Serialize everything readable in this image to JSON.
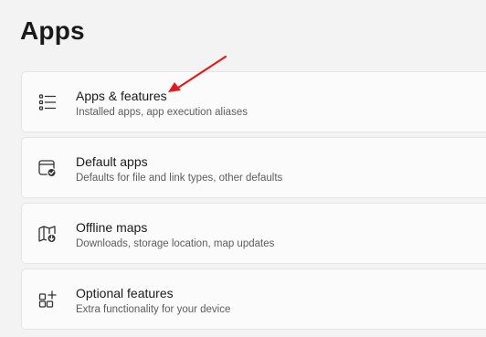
{
  "page": {
    "title": "Apps"
  },
  "items": [
    {
      "title": "Apps & features",
      "subtitle": "Installed apps, app execution aliases",
      "icon": "apps-list-icon"
    },
    {
      "title": "Default apps",
      "subtitle": "Defaults for file and link types, other defaults",
      "icon": "default-apps-icon"
    },
    {
      "title": "Offline maps",
      "subtitle": "Downloads, storage location, map updates",
      "icon": "offline-map-icon"
    },
    {
      "title": "Optional features",
      "subtitle": "Extra functionality for your device",
      "icon": "optional-features-icon"
    }
  ],
  "annotation": {
    "arrow_color": "#e01b1b"
  },
  "colors": {
    "background": "#f3f3f3",
    "card": "#fbfbfb",
    "card_border": "#e5e5e5"
  }
}
